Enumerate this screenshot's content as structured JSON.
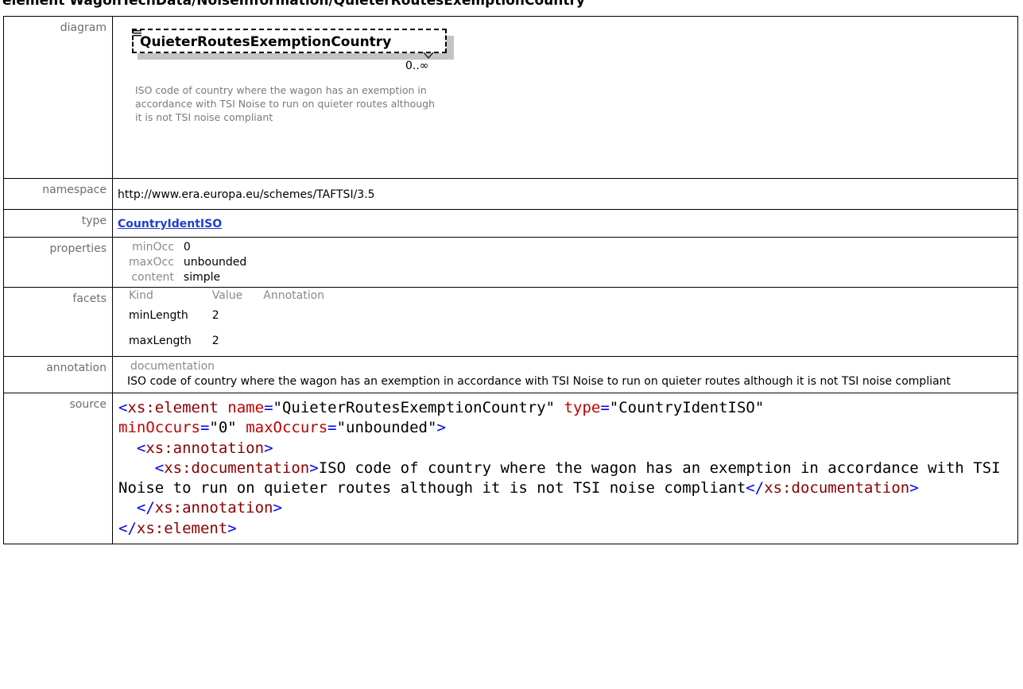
{
  "page_heading": "element WagonTechData/NoiseInformation/QuieterRoutesExemptionCountry",
  "labels": {
    "diagram": "diagram",
    "namespace": "namespace",
    "type": "type",
    "properties": "properties",
    "facets": "facets",
    "annotation": "annotation",
    "source": "source"
  },
  "diagram": {
    "element_name": "QuieterRoutesExemptionCountry",
    "cardinality": "0..∞",
    "documentation": "ISO code of country where the wagon has an exemption in accordance with TSI Noise to run on quieter routes although it is not TSI noise compliant"
  },
  "namespace": "http://www.era.europa.eu/schemes/TAFTSI/3.5",
  "type_link": "CountryIdentISO",
  "properties": [
    {
      "key": "minOcc",
      "value": "0"
    },
    {
      "key": "maxOcc",
      "value": "unbounded"
    },
    {
      "key": "content",
      "value": "simple"
    }
  ],
  "facets": {
    "headers": [
      "Kind",
      "Value",
      "Annotation"
    ],
    "rows": [
      {
        "kind": "minLength",
        "value": "2",
        "annotation": ""
      },
      {
        "kind": "maxLength",
        "value": "2",
        "annotation": ""
      }
    ]
  },
  "annotation": {
    "heading": "documentation",
    "text": "ISO code of country where the wagon has an exemption in accordance with TSI Noise to run on quieter routes although it is not TSI noise compliant"
  },
  "source": {
    "element_open": "xs:element",
    "attr_name": "name",
    "attr_name_value": "\"QuieterRoutesExemptionCountry\"",
    "attr_type": "type",
    "attr_type_value": "\"CountryIdentISO\"",
    "attr_minOccurs": "minOccurs",
    "attr_minOccurs_value": "\"0\"",
    "attr_maxOccurs": "maxOccurs",
    "attr_maxOccurs_value": "\"unbounded\"",
    "annotation_tag": "xs:annotation",
    "documentation_tag": "xs:documentation",
    "documentation_text": "ISO code of country where the wagon has an exemption in accordance with TSI Noise to run on quieter routes although it is not TSI noise compliant",
    "close_documentation": "xs:documentation",
    "close_annotation": "xs:annotation",
    "close_element": "xs:element"
  },
  "colors": {
    "link": "#1e3fcf",
    "xml_bracket": "#0000ff",
    "xml_tag_name": "#8b0000",
    "xml_attr": "#c00000",
    "label_gray": "#6e6e6e"
  }
}
